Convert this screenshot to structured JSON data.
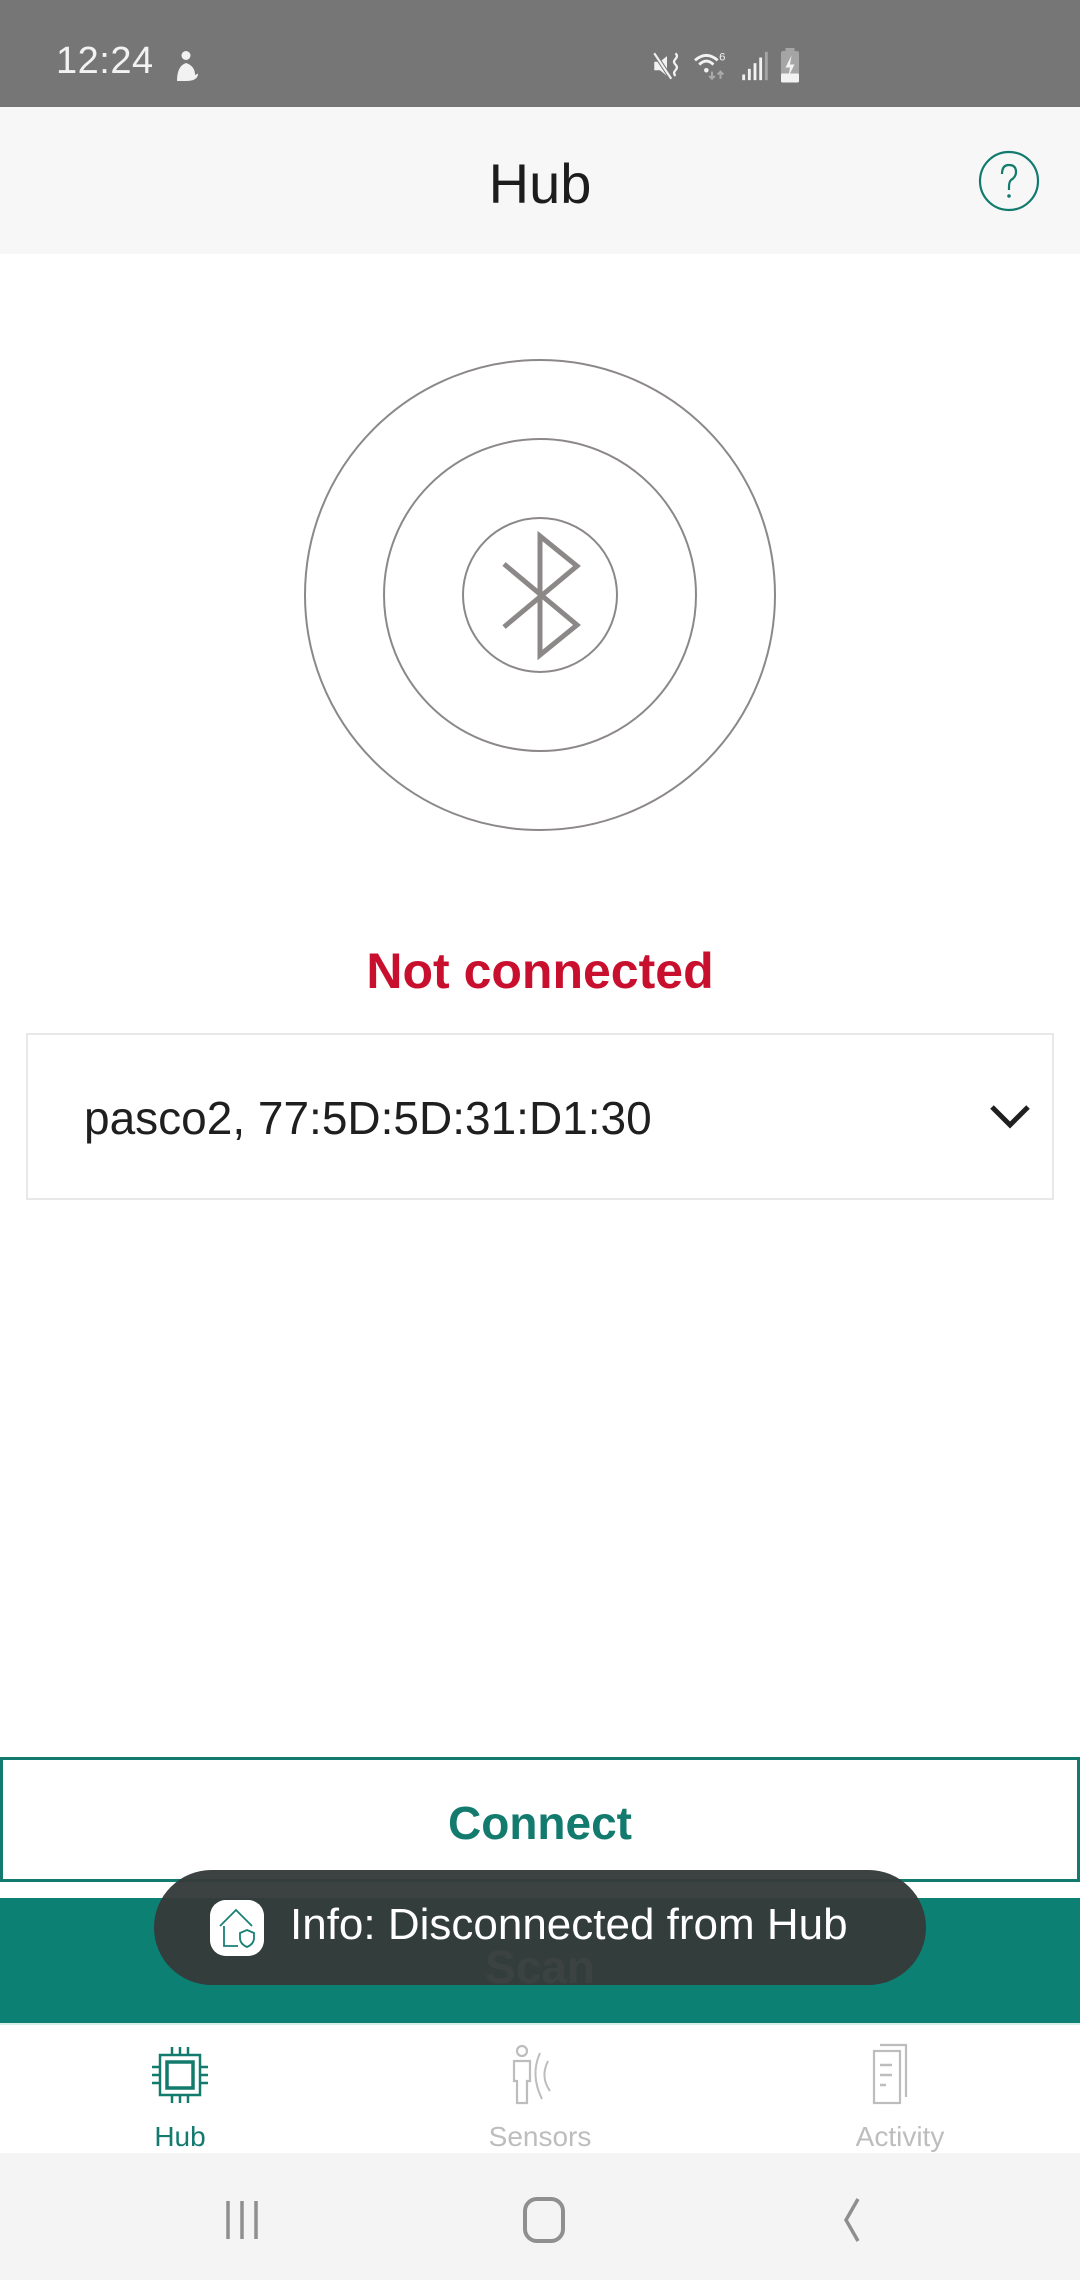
{
  "status_bar": {
    "time": "12:24",
    "icons": [
      "notification-person-icon",
      "mute-vibrate-icon",
      "wifi-6-icon",
      "cell-signal-icon",
      "battery-charging-icon"
    ]
  },
  "app_bar": {
    "title": "Hub",
    "help_icon": "help-circle-icon"
  },
  "main": {
    "radar_icon": "bluetooth-icon",
    "connection_status": "Not connected",
    "device_select": {
      "selected_value": "pasco2, 77:5D:5D:31:D1:30",
      "icon": "chevron-down-icon"
    },
    "connect_label": "Connect",
    "scan_label": "Scan"
  },
  "toast": {
    "icon": "home-shield-icon",
    "text": "Info: Disconnected from Hub"
  },
  "bottom_nav": {
    "items": [
      {
        "label": "Hub",
        "icon": "chip-icon",
        "active": true
      },
      {
        "label": "Sensors",
        "icon": "person-waves-icon",
        "active": false
      },
      {
        "label": "Activity",
        "icon": "document-icon",
        "active": false
      }
    ]
  },
  "system_nav": {
    "recents": "recents-icon",
    "home": "home-icon",
    "back": "back-icon"
  },
  "colors": {
    "accent": "#137a6e",
    "scan_bg": "#0d8074",
    "error": "#c8102e",
    "status_bar": "#767676",
    "inactive": "#bdbdbd"
  }
}
